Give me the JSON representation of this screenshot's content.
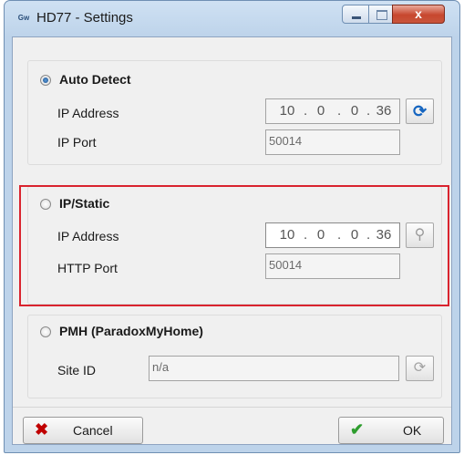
{
  "window": {
    "title": "HD77 - Settings",
    "logo_text": "Gw",
    "close_glyph": "x"
  },
  "auto_detect": {
    "label": "Auto Detect",
    "selected": true,
    "ip_label": "IP Address",
    "ip_octets": [
      "10",
      "0",
      "0",
      "36"
    ],
    "port_label": "IP Port",
    "port_value": "50014",
    "action_icon": "refresh-icon"
  },
  "ip_static": {
    "label": "IP/Static",
    "selected": false,
    "ip_label": "IP Address",
    "ip_octets": [
      "10",
      "0",
      "0",
      "36"
    ],
    "port_label": "HTTP Port",
    "port_value": "50014",
    "action_icon": "search-icon"
  },
  "pmh": {
    "label": "PMH (ParadoxMyHome)",
    "selected": false,
    "site_label": "Site ID",
    "site_value": "n/a",
    "action_icon": "refresh-icon"
  },
  "buttons": {
    "cancel": "Cancel",
    "ok": "OK"
  },
  "colors": {
    "highlight_border": "#d9232e",
    "cancel_icon": "#c00000",
    "ok_icon": "#2e9d2e"
  }
}
